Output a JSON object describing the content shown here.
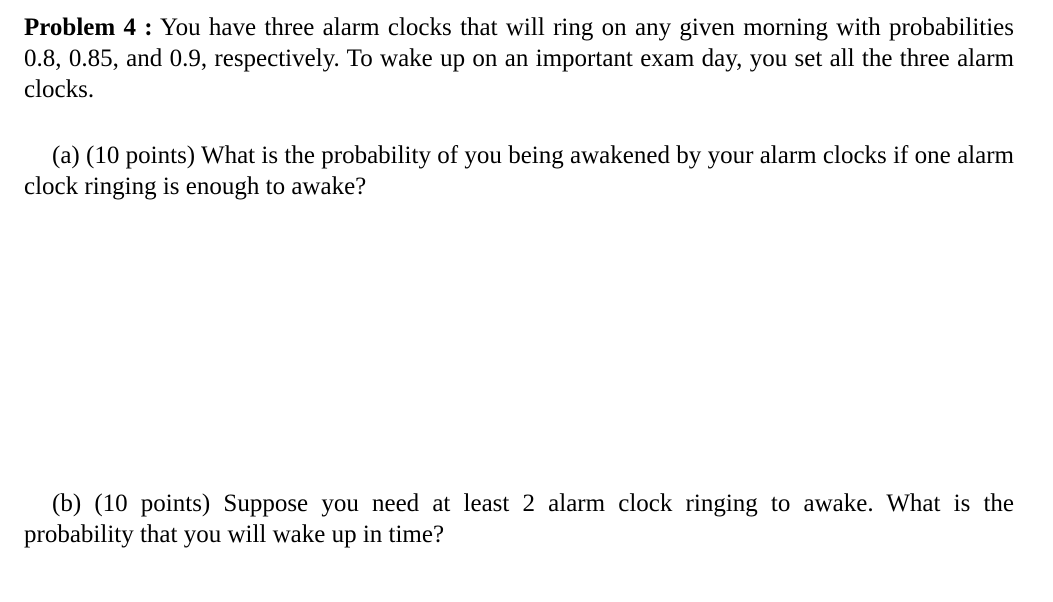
{
  "problem": {
    "heading": "Problem 4 :",
    "text": "You have three alarm clocks that will ring on any given morning with probabilities 0.8, 0.85, and 0.9, respectively. To wake up on an important exam day, you set all the three alarm clocks."
  },
  "parts": [
    {
      "label": "(a) (10 points)",
      "text": "What is the probability of you being awakened by your alarm clocks if one alarm clock ringing is enough to awake?"
    },
    {
      "label": "(b) (10 points)",
      "text": "Suppose you need at least 2 alarm clock ringing to awake. What is the probability that you will wake up in time?"
    }
  ]
}
